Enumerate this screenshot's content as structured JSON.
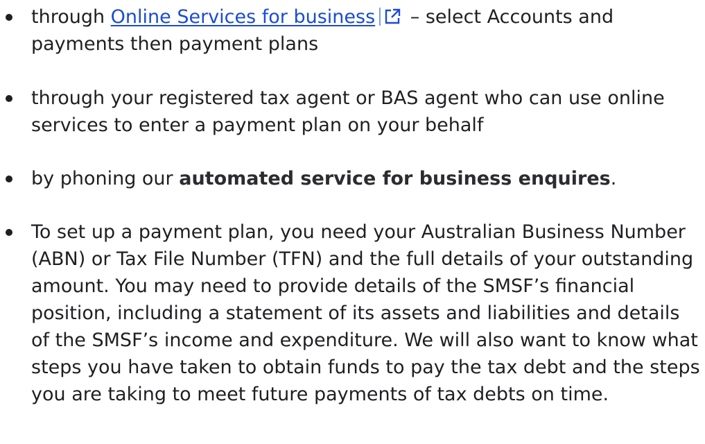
{
  "list": {
    "item1": {
      "pre": "through ",
      "link_text": "Online Services for business",
      "post": " – select Accounts and payments then payment plans"
    },
    "item2": {
      "text": "through your registered tax agent or BAS agent who can use online services to enter a payment plan on your behalf"
    },
    "item3": {
      "pre": "by phoning our ",
      "strong": "automated service for business enquires",
      "post": "."
    },
    "item4": {
      "text": "To set up a payment plan, you need your Australian Business Number (ABN) or Tax File Number (TFN) and the full details of your outstanding amount. You may need to provide details of the SMSF’s financial position, including a statement of its assets and liabilities and details of the SMSF’s income and expenditure. We will also want to know what steps you have taken to obtain funds to pay the tax debt and the steps you are taking to meet future payments of tax debts on time."
    }
  },
  "icons": {
    "external_link": "external-link-icon"
  },
  "colors": {
    "link": "#1a4bd6",
    "text": "#1f1f23"
  }
}
